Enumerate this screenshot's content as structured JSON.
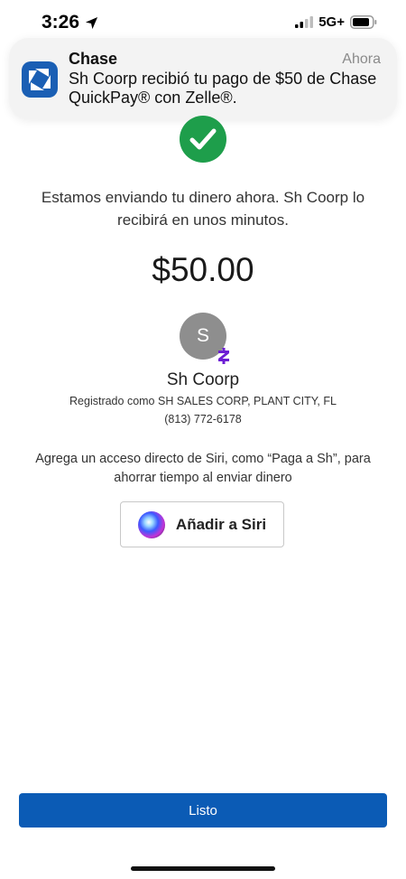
{
  "status_bar": {
    "time": "3:26",
    "network": "5G+",
    "location_icon": "location-arrow-icon",
    "signal_icon": "cellular-signal-icon",
    "battery_icon": "battery-icon"
  },
  "notification": {
    "app_name": "Chase",
    "time": "Ahora",
    "body": "Sh Coorp  recibió tu pago de $50 de Chase QuickPay® con Zelle®.",
    "icon": "chase-logo-icon",
    "brand_color": "#1a5fb4"
  },
  "confirmation": {
    "icon": "checkmark-icon",
    "icon_color": "#1e9e4b",
    "message": "Estamos enviando tu dinero ahora. Sh Coorp lo recibirá en unos minutos.",
    "amount": "$50.00"
  },
  "recipient": {
    "avatar_initial": "S",
    "badge_icon": "zelle-icon",
    "badge_color": "#6d1ed4",
    "name": "Sh Coorp",
    "registered": "Registrado como SH SALES CORP, PLANT CITY, FL",
    "phone": "(813) 772-6178"
  },
  "siri": {
    "prompt": "Agrega un acceso directo de Siri, como “Paga a Sh”, para ahorrar tiempo al enviar dinero",
    "button_label": "Añadir a Siri",
    "icon": "siri-orb-icon"
  },
  "footer": {
    "done_label": "Listo",
    "button_color": "#0b5bb5"
  }
}
